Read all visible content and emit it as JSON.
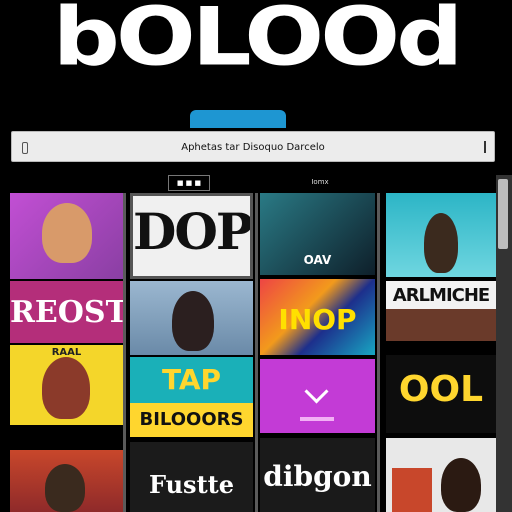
{
  "brand": {
    "logo_text": "bOLOOd"
  },
  "search": {
    "text": "Aphetas tar Disoquo Darcelo"
  },
  "header": {
    "filter_label": "■ ■ ■",
    "section_label": "Iomx"
  },
  "tiles": [
    {
      "id": "t1",
      "text": "",
      "bg": "#c24fd4"
    },
    {
      "id": "t2",
      "text": "DOP",
      "bg": "#2a2a2a"
    },
    {
      "id": "t3",
      "text": "OAV",
      "bg": "#1a4f5f"
    },
    {
      "id": "t4",
      "text": "",
      "bg": "#2cb5c6"
    },
    {
      "id": "t5",
      "text": "REOST",
      "bg": "#b42e7a"
    },
    {
      "id": "t6",
      "text": "",
      "bg": "#7a9bb5"
    },
    {
      "id": "t7",
      "text": "INOP",
      "bg": "#1d2f8c"
    },
    {
      "id": "t8",
      "text": "ARLMICHE",
      "bg": "#f2f2f2"
    },
    {
      "id": "t9",
      "text": "RAAL",
      "bg": "#f4d62a"
    },
    {
      "id": "t10",
      "text": "TAP",
      "bg": "#1ab0b8"
    },
    {
      "id": "t11",
      "text": "BILOOORS",
      "bg": "#ffd62e"
    },
    {
      "id": "t12",
      "text": "",
      "bg": "#c33bd6"
    },
    {
      "id": "t13",
      "text": "OOL",
      "bg": "#0d0d0d"
    },
    {
      "id": "t14",
      "text": "",
      "bg": "#c8472b"
    },
    {
      "id": "t15",
      "text": "Fustte",
      "bg": "#1b1b1b"
    },
    {
      "id": "t16",
      "text": "dibgon",
      "bg": "#1a1a1a"
    },
    {
      "id": "t17",
      "text": "",
      "bg": "#e8e8e8"
    }
  ],
  "colors": {
    "accent": "#1e96d2",
    "background": "#000000"
  }
}
